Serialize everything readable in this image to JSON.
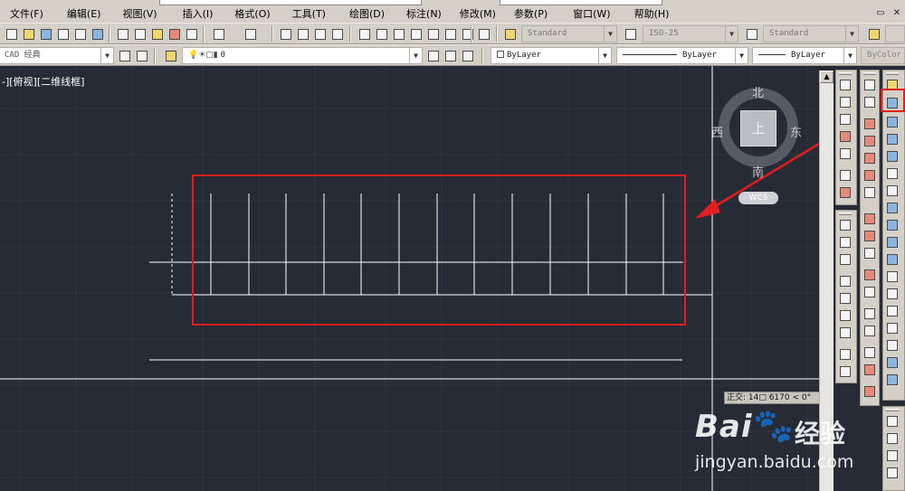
{
  "menubar": {
    "items": [
      "文件(F)",
      "编辑(E)",
      "视图(V)",
      "插入(I)",
      "格式(O)",
      "工具(T)",
      "绘图(D)",
      "标注(N)",
      "修改(M)",
      "参数(P)",
      "窗口(W)",
      "帮助(H)"
    ]
  },
  "toolbar1": {
    "text_style": "Standard",
    "dim_style": "ISO-25",
    "table_style": "Standard"
  },
  "toolbar2": {
    "workspace": "CAD 经典",
    "layer": "0",
    "color": "ByLayer",
    "linetype": "ByLayer",
    "lineweight": "ByLayer",
    "plotstyle": "ByColor"
  },
  "viewport": {
    "label": "-][俯视][二维线框]"
  },
  "viewcube": {
    "north": "北",
    "south": "南",
    "east": "东",
    "west": "西",
    "face": "上",
    "wcs": "WCS"
  },
  "coordinate_tooltip": "正交: 14□ 6170 < 0°",
  "watermark": {
    "brand": "Bai",
    "brand_suffix": "经验",
    "url": "jingyan.baidu.com"
  },
  "colors": {
    "canvas_bg": "#262b36",
    "annotation": "#e01e1e",
    "ui_face": "#d4d0c8"
  }
}
